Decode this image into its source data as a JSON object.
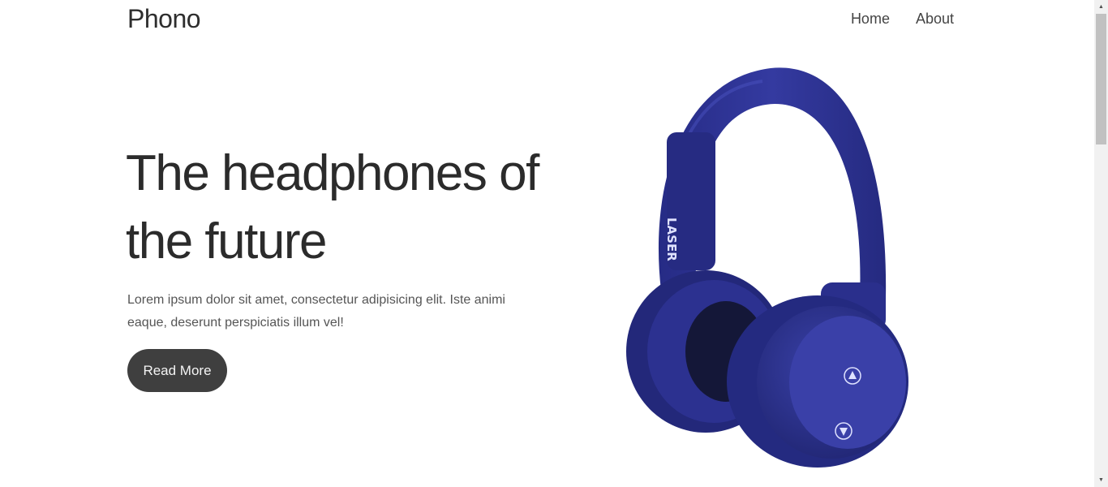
{
  "header": {
    "brand": "Phono",
    "nav": [
      {
        "label": "Home"
      },
      {
        "label": "About"
      }
    ]
  },
  "hero": {
    "title": "The headphones of the future",
    "description": "Lorem ipsum dolor sit amet, consectetur adipisicing elit. Iste animi eaque, deserunt perspiciatis illum vel!",
    "button_label": "Read More",
    "image": {
      "icon": "headphones-image",
      "brand_text": "LASER",
      "color": "#2b3190"
    }
  },
  "colors": {
    "button_bg": "#3f3f3f",
    "text": "#2b2b2b",
    "headphone_blue": "#2b3190"
  }
}
